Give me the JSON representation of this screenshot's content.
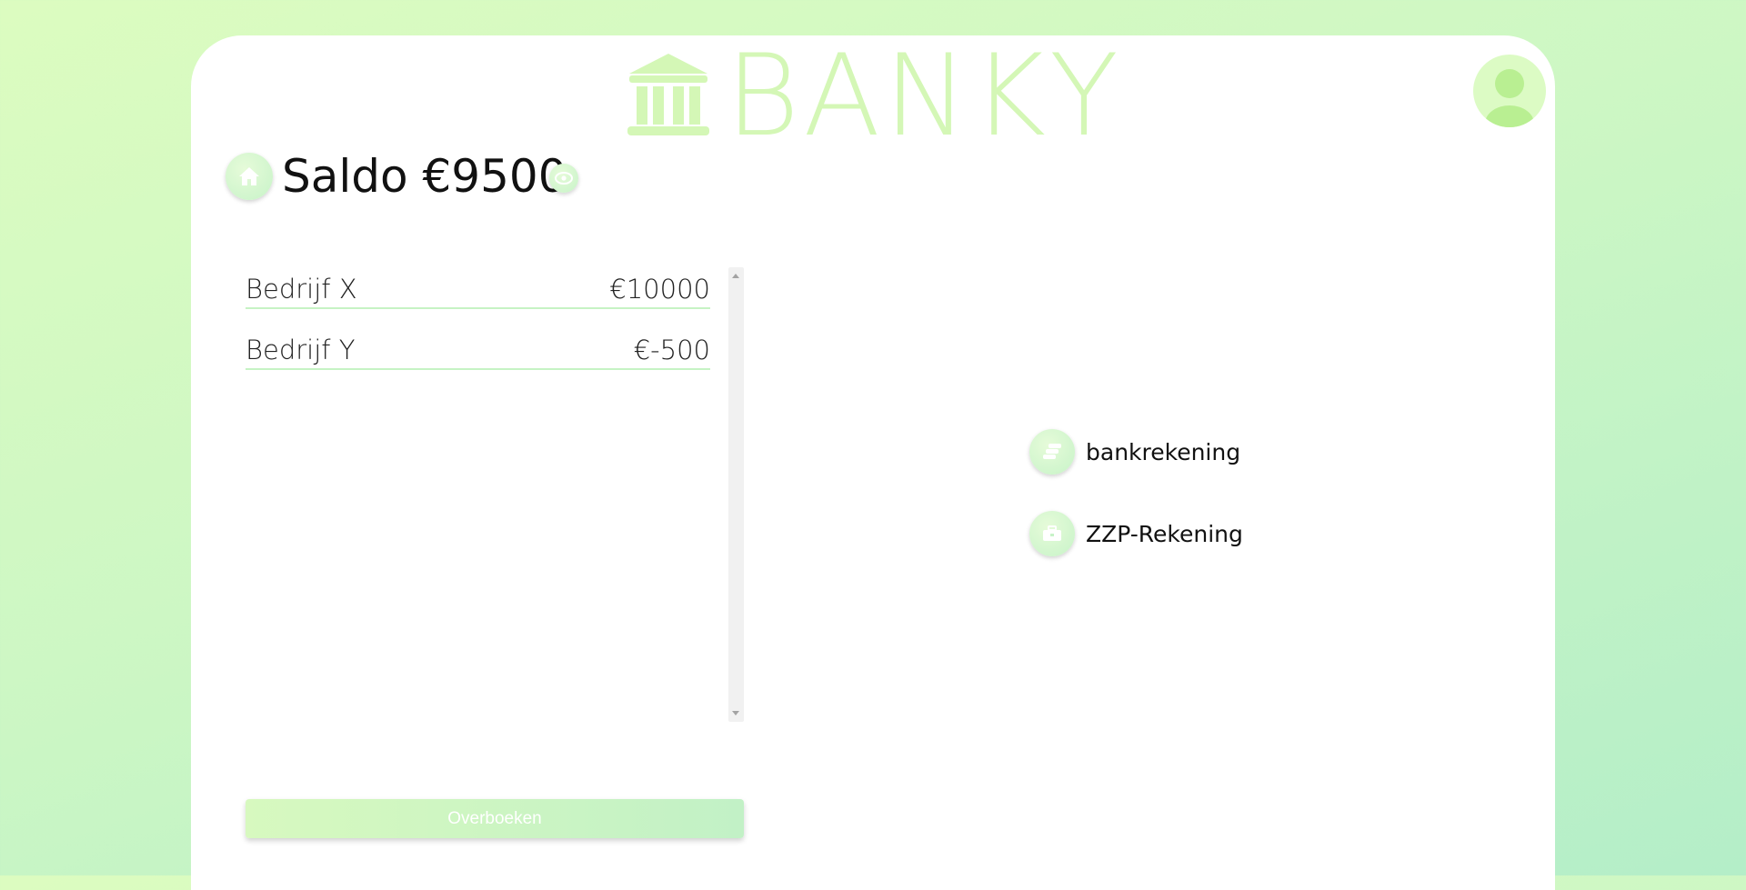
{
  "app": {
    "name": "BANKY",
    "brand_color": "#d4f7b6",
    "accent_color": "#c6f3c4"
  },
  "header": {
    "logo_icon": "bank-icon",
    "logo_text": "BANKY",
    "avatar_icon": "user-avatar-icon"
  },
  "balance": {
    "home_icon": "home-icon",
    "text": "Saldo €9500",
    "visibility_icon": "eye-icon"
  },
  "transactions": [
    {
      "name": "Bedrijf X",
      "amount": "€10000"
    },
    {
      "name": "Bedrijf Y",
      "amount": "€-500"
    }
  ],
  "accounts": [
    {
      "icon": "coins-icon",
      "label": "bankrekening"
    },
    {
      "icon": "briefcase-icon",
      "label": "ZZP-Rekening"
    }
  ],
  "actions": {
    "transfer_label": "Overboeken"
  }
}
